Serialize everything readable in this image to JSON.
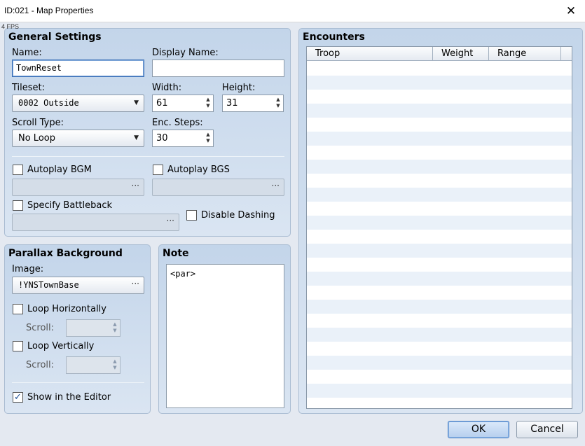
{
  "window": {
    "title": "ID:021 - Map Properties",
    "close_glyph": "✕",
    "fps": "4 FPS"
  },
  "general": {
    "title": "General Settings",
    "name_label": "Name:",
    "name_value": "TownReset",
    "display_name_label": "Display Name:",
    "display_name_value": "",
    "tileset_label": "Tileset:",
    "tileset_value": "0002 Outside",
    "width_label": "Width:",
    "width_value": "61",
    "height_label": "Height:",
    "height_value": "31",
    "scroll_type_label": "Scroll Type:",
    "scroll_type_value": "No Loop",
    "enc_steps_label": "Enc. Steps:",
    "enc_steps_value": "30",
    "autoplay_bgm_label": "Autoplay BGM",
    "autoplay_bgs_label": "Autoplay BGS",
    "specify_battleback_label": "Specify Battleback",
    "disable_dashing_label": "Disable Dashing",
    "autoplay_bgm_checked": false,
    "autoplay_bgs_checked": false,
    "specify_battleback_checked": false,
    "disable_dashing_checked": false
  },
  "parallax": {
    "title": "Parallax Background",
    "image_label": "Image:",
    "image_value": "!YNSTownBase",
    "loop_h_label": "Loop Horizontally",
    "loop_v_label": "Loop Vertically",
    "scroll_label": "Scroll:",
    "show_editor_label": "Show in the Editor",
    "loop_h_checked": false,
    "loop_v_checked": false,
    "show_editor_checked": true
  },
  "note": {
    "title": "Note",
    "text": "<par>"
  },
  "encounters": {
    "title": "Encounters",
    "columns": [
      "Troop",
      "Weight",
      "Range"
    ]
  },
  "buttons": {
    "ok": "OK",
    "cancel": "Cancel"
  },
  "glyphs": {
    "ellipsis": "···",
    "dropdown": "▼",
    "spin_up": "▲",
    "spin_down": "▼",
    "check": "✓"
  },
  "colors": {
    "panel_top": "#c3d5ea",
    "panel_bottom": "#dae5f2",
    "row_alt": "#eaf1f9",
    "dialog_bg": "#e4e9f1",
    "accent": "#4a7fc4"
  }
}
